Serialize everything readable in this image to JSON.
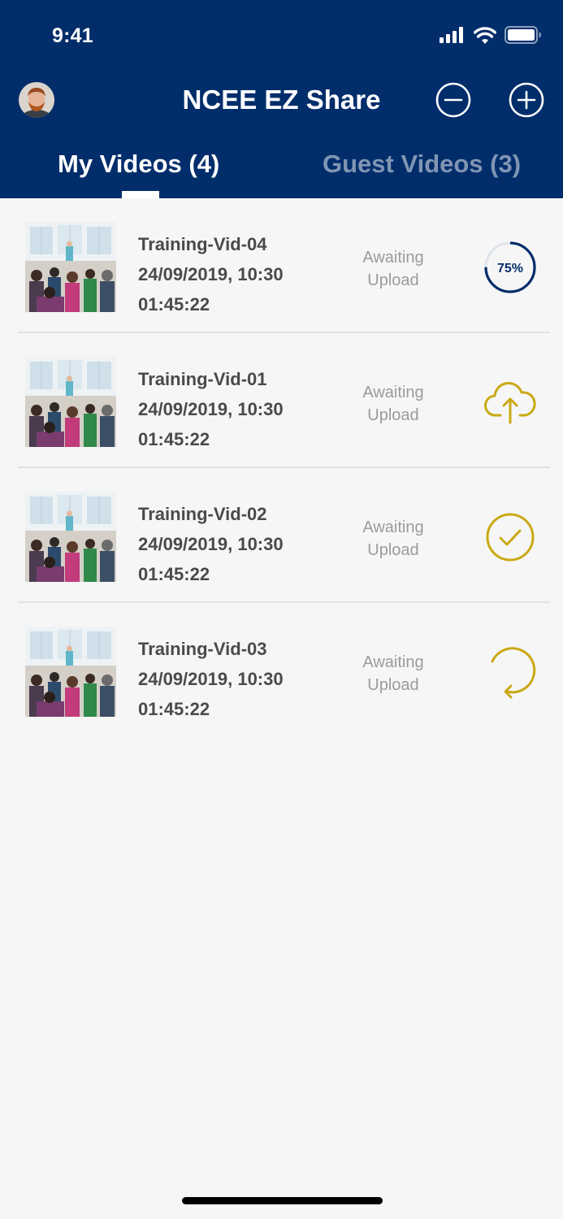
{
  "status_bar": {
    "time": "9:41",
    "icons": [
      "cellular-signal-icon",
      "wifi-icon",
      "battery-icon"
    ]
  },
  "header": {
    "title": "NCEE EZ Share",
    "avatar": "user-avatar",
    "left_action_icon": "minus-circle-icon",
    "right_action_icon": "plus-circle-icon"
  },
  "tabs": [
    {
      "label": "My Videos (4)",
      "selected": true
    },
    {
      "label": "Guest Videos (3)",
      "selected": false
    }
  ],
  "videos": [
    {
      "name": "Training-Vid-04",
      "datetime": "24/09/2019, 10:30",
      "duration": "01:45:22",
      "status_line1": "Awaiting",
      "status_line2": "Upload",
      "action_icon": "progress-ring-icon",
      "progress_label": "75%",
      "progress": 0.75
    },
    {
      "name": "Training-Vid-01",
      "datetime": "24/09/2019, 10:30",
      "duration": "01:45:22",
      "status_line1": "Awaiting",
      "status_line2": "Upload",
      "action_icon": "cloud-upload-icon"
    },
    {
      "name": "Training-Vid-02",
      "datetime": "24/09/2019, 10:30",
      "duration": "01:45:22",
      "status_line1": "Awaiting",
      "status_line2": "Upload",
      "action_icon": "check-circle-icon"
    },
    {
      "name": "Training-Vid-03",
      "datetime": "24/09/2019, 10:30",
      "duration": "01:45:22",
      "status_line1": "Awaiting",
      "status_line2": "Upload",
      "action_icon": "retry-icon"
    }
  ],
  "colors": {
    "header_bg": "#012d6b",
    "accent_gold": "#c9a915",
    "progress_blue": "#012d6b",
    "inactive_tab": "#8095b3",
    "body_bg": "#f6f6f6"
  }
}
